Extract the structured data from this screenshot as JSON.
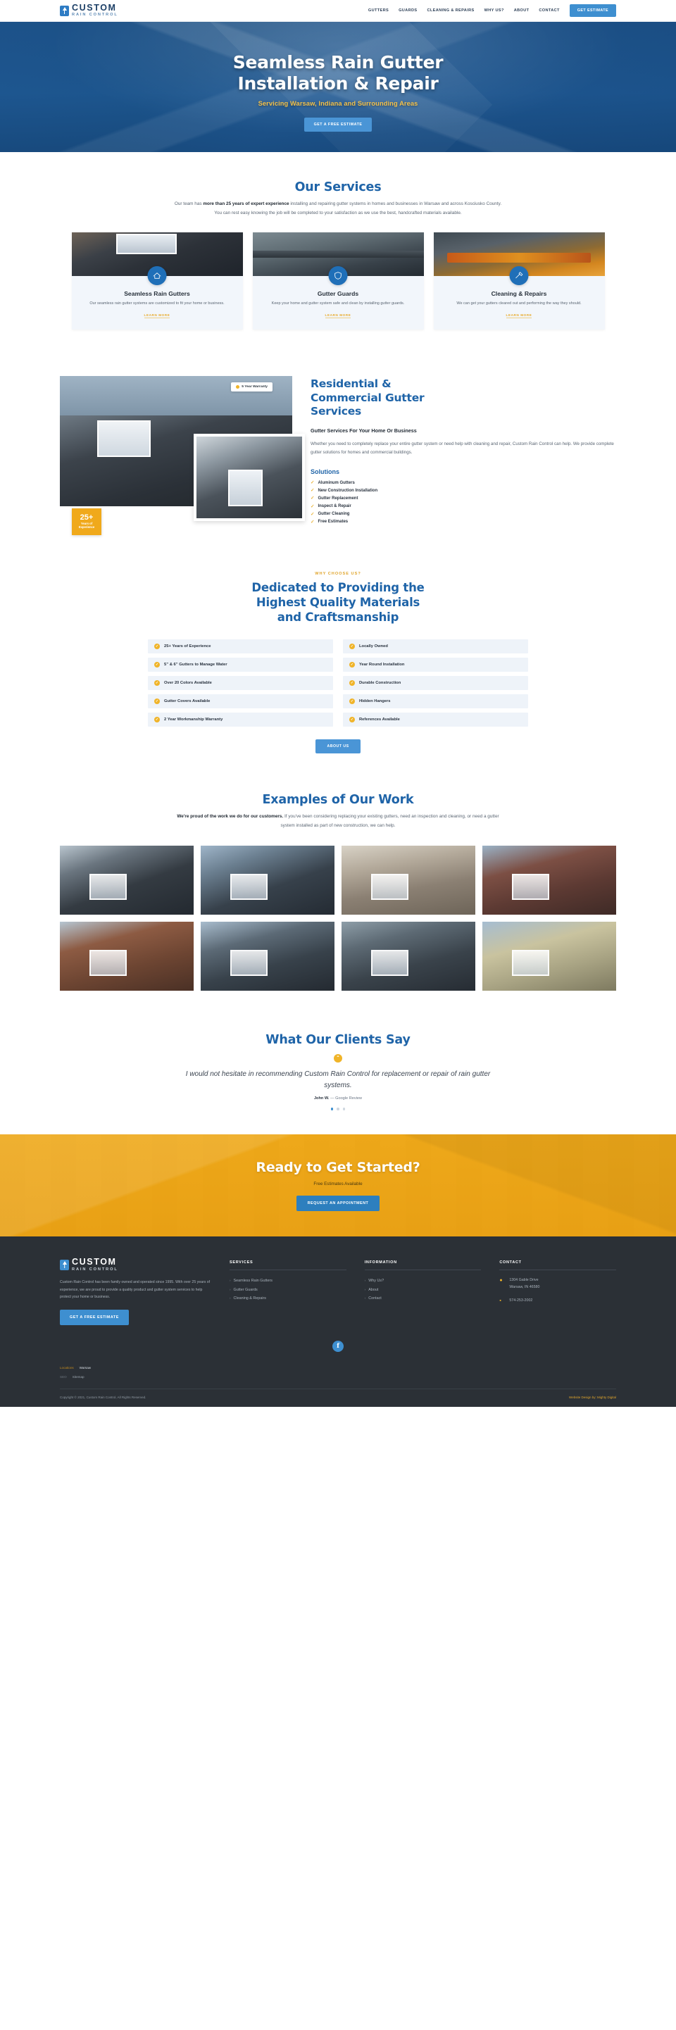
{
  "header": {
    "brand": {
      "name": "CUSTOM",
      "sub": "RAIN CONTROL",
      "icon": "house-logo-icon"
    },
    "nav": [
      {
        "label": "GUTTERS"
      },
      {
        "label": "GUARDS"
      },
      {
        "label": "CLEANING & REPAIRS"
      },
      {
        "label": "WHY US?"
      },
      {
        "label": "ABOUT"
      },
      {
        "label": "CONTACT"
      }
    ],
    "cta_label": "GET ESTIMATE"
  },
  "hero": {
    "title_line1": "Seamless Rain Gutter",
    "title_line2": "Installation & Repair",
    "subtitle": "Servicing Warsaw, Indiana and Surrounding Areas",
    "cta_label": "GET A FREE ESTIMATE"
  },
  "services": {
    "heading": "Our Services",
    "intro_lead": "Our team has ",
    "intro_bold": "more than 25 years of expert experience",
    "intro_rest": " installing and repairing gutter systems in homes and businesses in Warsaw and across Kosciusko County. You can rest easy knowing the job will be completed to your satisfaction as we use the best, handcrafted materials available.",
    "cards": [
      {
        "title": "Seamless Rain Gutters",
        "desc": "Our seamless rain gutter systems are customized to fit your home or business.",
        "link": "LEARN MORE",
        "icon": "gutter-icon"
      },
      {
        "title": "Gutter Guards",
        "desc": "Keep your home and gutter system safe and clean by installing gutter guards.",
        "link": "LEARN MORE",
        "icon": "guard-icon"
      },
      {
        "title": "Cleaning & Repairs",
        "desc": "We can get your gutters cleared out and performing the way they should.",
        "link": "LEARN MORE",
        "icon": "cleaning-icon"
      }
    ]
  },
  "residential": {
    "warranty_badge": "5 Year Warranty",
    "years_number": "25+",
    "years_label_1": "Years of",
    "years_label_2": "Experience",
    "title_line1": "Residential &",
    "title_line2": "Commercial Gutter",
    "title_line3": "Services",
    "lead": "Gutter Services For Your Home Or Business",
    "body": "Whether you need to completely replace your entire gutter system or need help with cleaning and repair, Custom Rain Control can help. We provide complete gutter solutions for homes and commercial buildings.",
    "solutions_title": "Solutions",
    "solutions": [
      "Aluminum Gutters",
      "New Construction Installation",
      "Gutter Replacement",
      "Inspect & Repair",
      "Gutter Cleaning",
      "Free Estimates"
    ]
  },
  "why": {
    "eyebrow": "WHY CHOOSE US?",
    "title_line1": "Dedicated to Providing the",
    "title_line2": "Highest Quality Materials",
    "title_line3": "and Craftsmanship",
    "items_left": [
      "25+ Years of Experience",
      "5” & 6” Gutters to Manage Water",
      "Over 20 Colors Available",
      "Gutter Covers Available",
      "2 Year Workmanship Warranty"
    ],
    "items_right": [
      "Locally Owned",
      "Year Round Installation",
      "Durable Construction",
      "Hidden Hangers",
      "References Available"
    ],
    "cta_label": "ABOUT US"
  },
  "gallery": {
    "heading": "Examples of Our Work",
    "intro_bold": "We're proud of the work we do for our customers.",
    "intro_rest": " If you've been considering replacing your existing gutters, need an inspection and cleaning, or need a gutter system installed as part of new construction, we can help.",
    "images": [
      {
        "alt": "dark-siding-home-gutters"
      },
      {
        "alt": "blue-gray-home-gutters"
      },
      {
        "alt": "tan-home-gutter-detail"
      },
      {
        "alt": "red-barn-home-gutters"
      },
      {
        "alt": "brick-home-gutters"
      },
      {
        "alt": "gray-roof-home-gutters"
      },
      {
        "alt": "porch-column-gutters"
      },
      {
        "alt": "cream-siding-home-gutters"
      }
    ]
  },
  "testimonial": {
    "heading": "What Our Clients Say",
    "quote_icon": "quote-mark-icon",
    "text": "I would not hesitate in recommending Custom Rain Control for replacement or repair of rain gutter systems.",
    "author": "John W.",
    "source": "— Google Review",
    "dots": 3,
    "active_dot": 0
  },
  "cta": {
    "title": "Ready to Get Started?",
    "subtitle": "Free Estimates Available",
    "button": "REQUEST AN APPOINTMENT"
  },
  "footer": {
    "brand": {
      "name": "CUSTOM",
      "sub": "RAIN CONTROL"
    },
    "about": "Custom Rain Control has been family owned and operated since 1995. With over 25 years of experience, we are proud to provide a quality product and gutter system services to help protect your home or business.",
    "cta_label": "GET A FREE ESTIMATE",
    "services": {
      "heading": "SERVICES",
      "items": [
        "Seamless Rain Gutters",
        "Gutter Guards",
        "Cleaning & Repairs"
      ]
    },
    "information": {
      "heading": "INFORMATION",
      "items": [
        "Why Us?",
        "About",
        "Contact"
      ]
    },
    "contact": {
      "heading": "CONTACT",
      "address_line1": "1304 Gable Drive",
      "address_line2": "Warsaw, IN 46580",
      "phone": "574-253-2002",
      "map_icon": "location-pin-icon",
      "phone_icon": "phone-icon"
    },
    "social": {
      "facebook_icon": "facebook-icon",
      "facebook_label": "f"
    },
    "meta": {
      "locations_label": "Locations",
      "locations_value": "Warsaw",
      "seo_label": "SEO",
      "seo_value": "Sitemap"
    },
    "copyright": "Copyright © 2021, Custom Rain Control, All Rights Reserved.",
    "credit": "Website Design by: Mighty Digital"
  }
}
